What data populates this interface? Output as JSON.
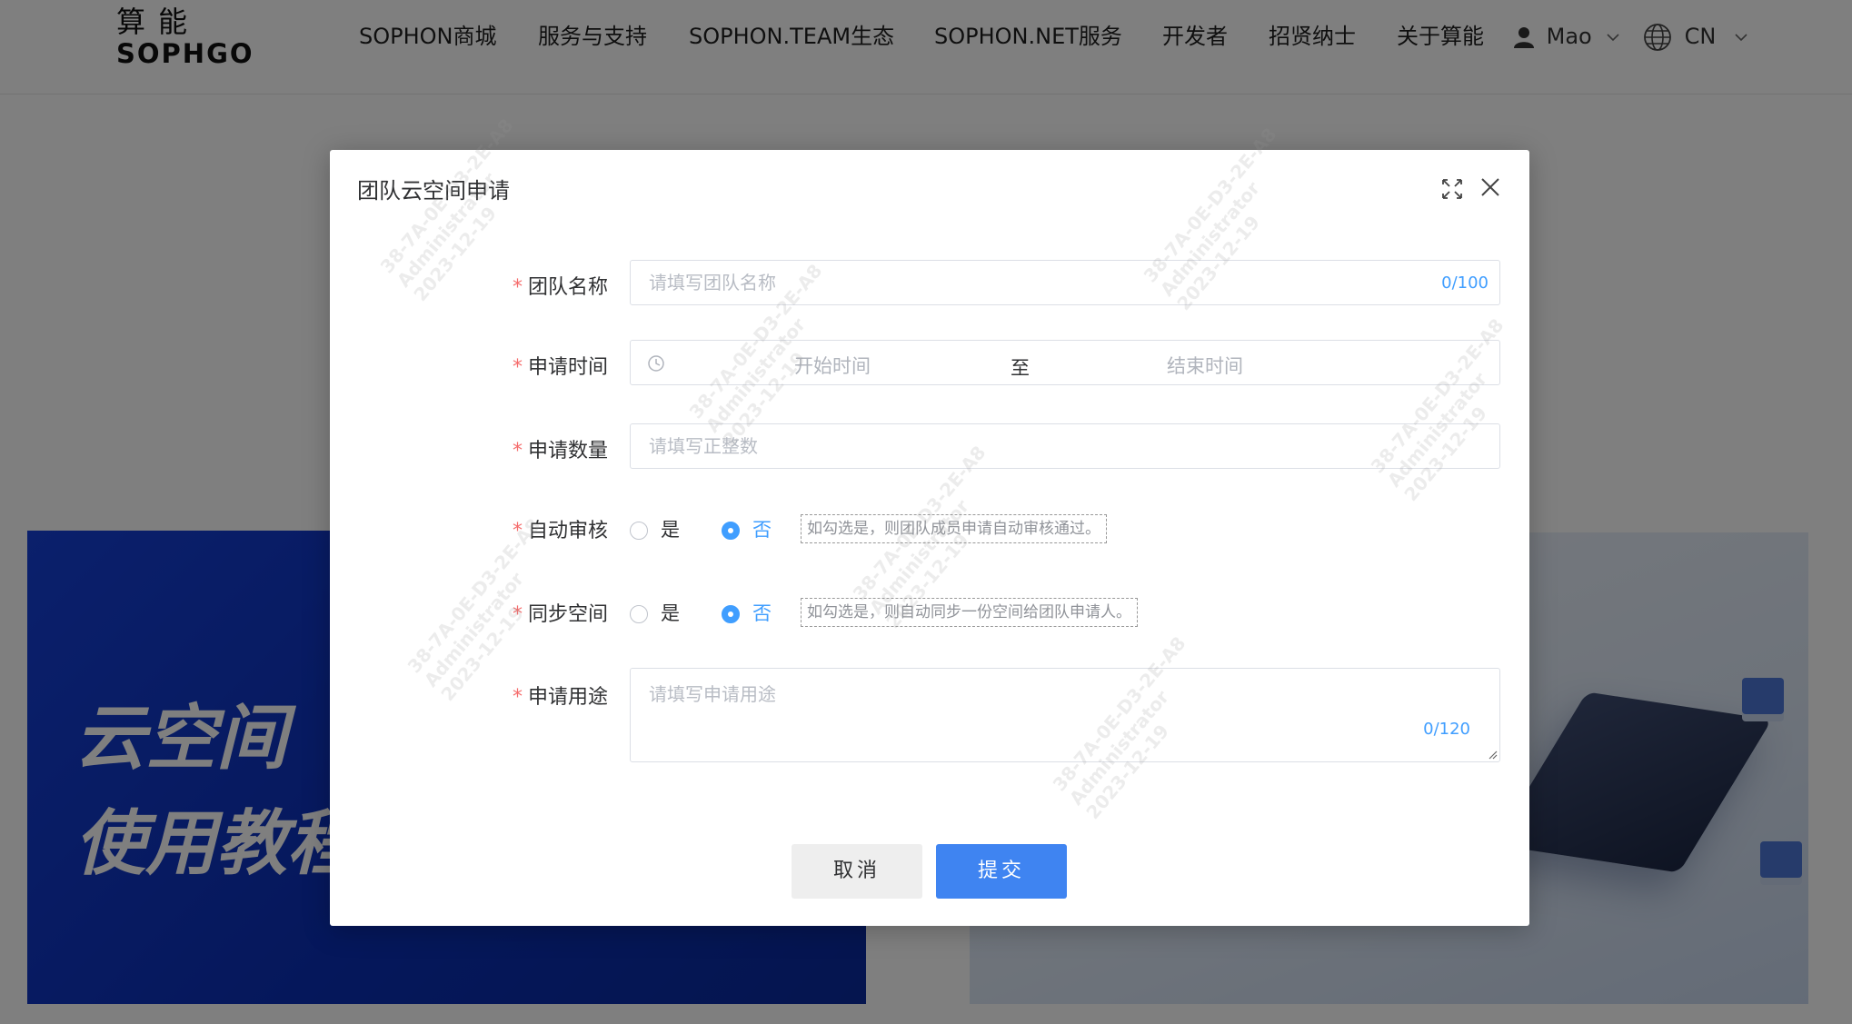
{
  "header": {
    "logo_cn": "算能",
    "logo_en": "SOPHGO",
    "nav": [
      {
        "label": "SOPHON商城"
      },
      {
        "label": "服务与支持"
      },
      {
        "label": "SOPHON.TEAM生态"
      },
      {
        "label": "SOPHON.NET服务"
      },
      {
        "label": "开发者"
      },
      {
        "label": "招贤纳士"
      },
      {
        "label": "关于算能"
      }
    ],
    "user_name": "Mao",
    "language": "CN"
  },
  "banner": {
    "left_line1": "云空间",
    "left_line2": "使用教程"
  },
  "dialog": {
    "title": "团队云空间申请",
    "fields": {
      "team_name": {
        "label": "团队名称",
        "placeholder": "请填写团队名称",
        "counter": "0/100"
      },
      "apply_time": {
        "label": "申请时间",
        "start_placeholder": "开始时间",
        "separator": "至",
        "end_placeholder": "结束时间"
      },
      "apply_count": {
        "label": "申请数量",
        "placeholder": "请填写正整数"
      },
      "auto_review": {
        "label": "自动审核",
        "yes": "是",
        "no": "否",
        "selected": "否",
        "hint": "如勾选是，则团队成员申请自动审核通过。"
      },
      "sync_space": {
        "label": "同步空间",
        "yes": "是",
        "no": "否",
        "selected": "否",
        "hint": "如勾选是，则自动同步一份空间给团队申请人。"
      },
      "purpose": {
        "label": "申请用途",
        "placeholder": "请填写申请用途",
        "counter": "0/120"
      }
    },
    "cancel_label": "取消",
    "submit_label": "提交"
  },
  "watermark": "38-7A-0E-D3-2E-A8\nAdministrator\n2023-12-19",
  "colors": {
    "primary": "#409eff",
    "required": "#f56c6c",
    "submit_button": "#3f84f1",
    "banner_blue": "#1640d8"
  }
}
